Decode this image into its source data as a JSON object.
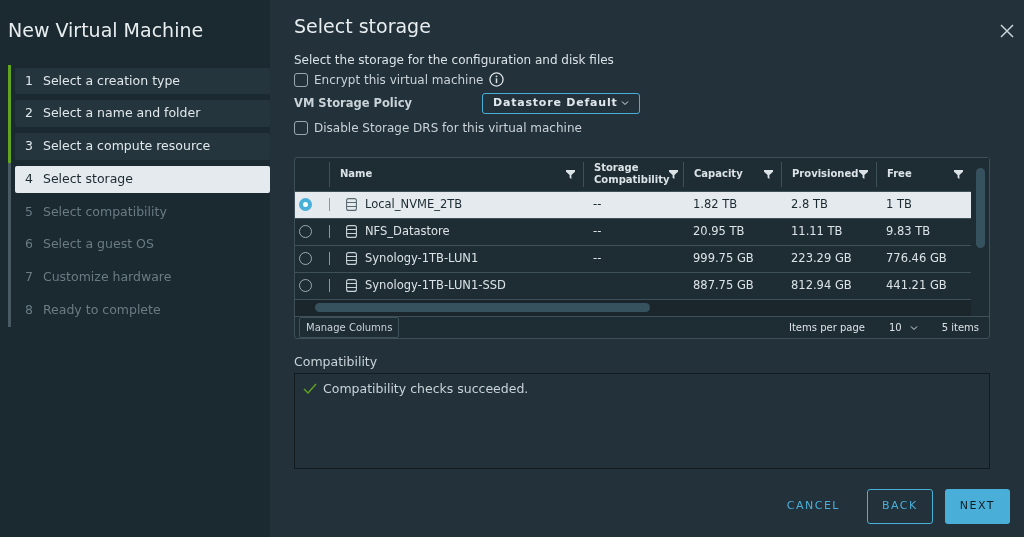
{
  "dialog": {
    "title": "New Virtual Machine"
  },
  "steps": [
    {
      "number": "1",
      "label": "Select a creation type",
      "completed": true,
      "selected": false,
      "disabled": false
    },
    {
      "number": "2",
      "label": "Select a name and folder",
      "completed": true,
      "selected": false,
      "disabled": false
    },
    {
      "number": "3",
      "label": "Select a compute resource",
      "completed": true,
      "selected": false,
      "disabled": false
    },
    {
      "number": "4",
      "label": "Select storage",
      "completed": false,
      "selected": true,
      "disabled": false
    },
    {
      "number": "5",
      "label": "Select compatibility",
      "completed": false,
      "selected": false,
      "disabled": true
    },
    {
      "number": "6",
      "label": "Select a guest OS",
      "completed": false,
      "selected": false,
      "disabled": true
    },
    {
      "number": "7",
      "label": "Customize hardware",
      "completed": false,
      "selected": false,
      "disabled": true
    },
    {
      "number": "8",
      "label": "Ready to complete",
      "completed": false,
      "selected": false,
      "disabled": true
    }
  ],
  "page": {
    "title": "Select storage",
    "description": "Select the storage for the configuration and disk files"
  },
  "options": [
    {
      "kind": "checkbox",
      "label": "Encrypt this virtual machine",
      "checked": false,
      "info": true
    },
    {
      "kind": "select",
      "label": "VM Storage Policy",
      "value": "Datastore Default"
    },
    {
      "kind": "checkbox",
      "label": "Disable Storage DRS for this virtual machine",
      "checked": false,
      "info": false
    }
  ],
  "table": {
    "columns": [
      {
        "label": "Name",
        "filter": true
      },
      {
        "label": "Storage Compatibility",
        "filter": true
      },
      {
        "label": "Capacity",
        "filter": true
      },
      {
        "label": "Provisioned",
        "filter": true
      },
      {
        "label": "Free",
        "filter": true
      }
    ],
    "rows": [
      {
        "name": "Local_NVME_2TB",
        "compatibility": "--",
        "capacity": "1.82 TB",
        "provisioned": "2.8 TB",
        "free": "1 TB",
        "selected": true
      },
      {
        "name": "NFS_Datastore",
        "compatibility": "--",
        "capacity": "20.95 TB",
        "provisioned": "11.11 TB",
        "free": "9.83 TB",
        "selected": false
      },
      {
        "name": "Synology-1TB-LUN1",
        "compatibility": "--",
        "capacity": "999.75 GB",
        "provisioned": "223.29 GB",
        "free": "776.46 GB",
        "selected": false
      },
      {
        "name": "Synology-1TB-LUN1-SSD",
        "capacity": "887.75 GB",
        "provisioned": "812.94 GB",
        "free": "441.21 GB",
        "selected": false
      }
    ],
    "manage_columns": "Manage Columns",
    "items_per_page_label": "Items per page",
    "items_per_page": "10",
    "total": "5 items"
  },
  "compatibility": {
    "label": "Compatibility",
    "succeeded": true,
    "message": "Compatibility checks succeeded."
  },
  "buttons": [
    {
      "label": "CANCEL",
      "kind": "link"
    },
    {
      "label": "BACK",
      "kind": "outline"
    },
    {
      "label": "NEXT",
      "kind": "primary"
    }
  ]
}
